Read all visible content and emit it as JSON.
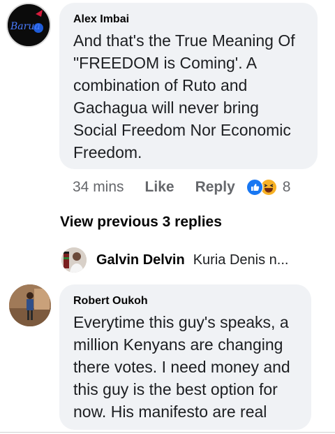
{
  "comment1": {
    "author": "Alex Imbai",
    "avatar_text": "Barua",
    "text": "And that's the True Meaning Of\n\"FREEDOM is Coming'. A\ncombination of Ruto and\nGachagua will never bring\nSocial Freedom Nor Economic\nFreedom.",
    "time": "34 mins",
    "like_label": "Like",
    "reply_label": "Reply",
    "reaction_count": "8",
    "reaction_icons": [
      "like-icon",
      "haha-icon"
    ]
  },
  "replies": {
    "view_previous_label": "View previous 3 replies",
    "latest_author": "Galvin Delvin",
    "latest_preview": "Kuria Denis n..."
  },
  "comment2": {
    "author": "Robert Oukoh",
    "text": "Everytime this guy's speaks, a\nmillion Kenyans are changing\nthere votes. I need money and\nthis guy is the best option for\nnow. His manifesto are real"
  },
  "colors": {
    "bubble": "#f0f2f5",
    "meta_text": "#65676b",
    "like_blue": "#1877f2",
    "haha_yellow": "#f7b125"
  }
}
